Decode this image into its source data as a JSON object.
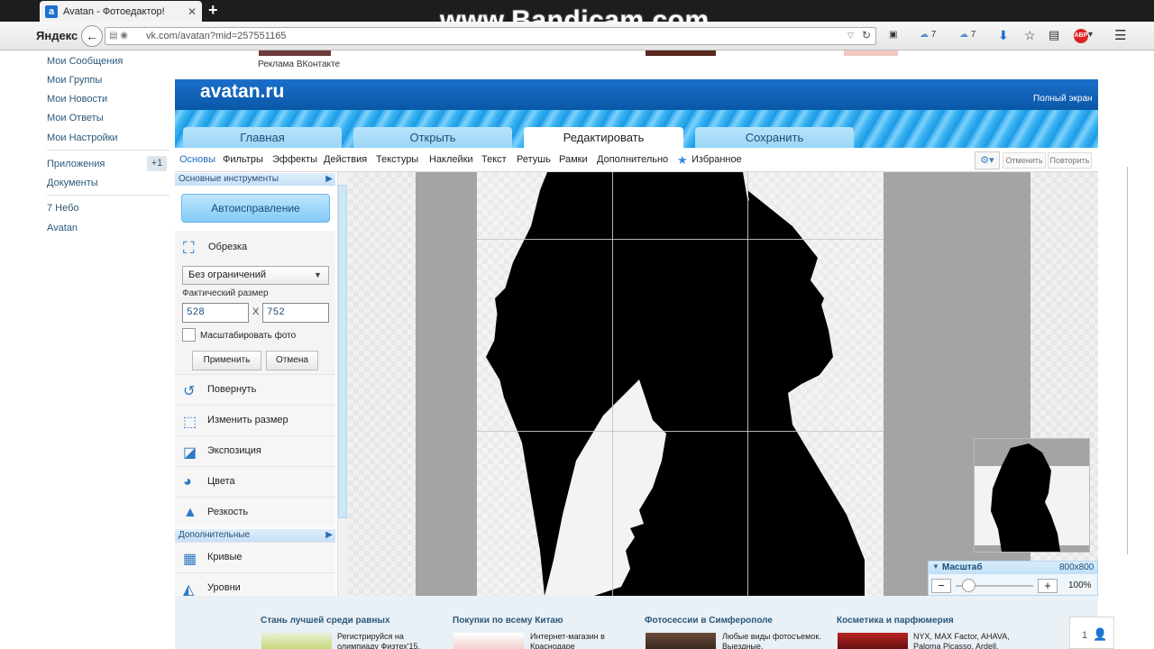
{
  "browser": {
    "tab_title": "Avatan - Фотоедактор!",
    "tab_favicon": "a",
    "watermark": "www.Bandicam.com",
    "search_brand": "Яндекс",
    "url": "vk.com/avatan?mid=257551165",
    "toolbar": {
      "cloud1_count": "7",
      "cloud2_count": "7",
      "abp": "ABP"
    }
  },
  "vk_menu": {
    "items": [
      "Мои Сообщения",
      "Мои Группы",
      "Мои Новости",
      "Мои Ответы",
      "Мои Настройки",
      "Приложения",
      "Документы",
      "7 Небо",
      "Avatan"
    ],
    "apps_badge": "+1"
  },
  "ad_top": {
    "caption": "Реклама ВКонтакте"
  },
  "avatan": {
    "logo": "avatan.ru",
    "fullscreen": "Полный экран",
    "tabs": [
      "Главная",
      "Открыть",
      "Редактировать",
      "Сохранить"
    ],
    "menu": [
      "Основы",
      "Фильтры",
      "Эффекты",
      "Действия",
      "Текстуры",
      "Наклейки",
      "Текст",
      "Ретушь",
      "Рамки",
      "Дополнительно",
      "Избранное"
    ],
    "undo": "Отменить",
    "redo": "Повторить"
  },
  "tools_panel": {
    "section_basic": "Основные инструменты",
    "auto_button": "Автоисправление",
    "crop": {
      "title": "Обрезка",
      "aspect": "Без ограничений",
      "size_label": "Фактический размер",
      "width": "528",
      "height": "752",
      "sep": "X",
      "scale_label": "Масштабировать фото",
      "apply": "Применить",
      "cancel": "Отмена"
    },
    "tools": [
      "Повернуть",
      "Изменить размер",
      "Экспозиция",
      "Цвета",
      "Резкость"
    ],
    "section_extra": "Дополнительные",
    "extra_tools": [
      "Кривые",
      "Уровни"
    ]
  },
  "zoom": {
    "title": "Масштаб",
    "size": "800x800",
    "percent": "100%",
    "level": 0.1
  },
  "bottom_ads": [
    {
      "title": "Стань лучшей среди равных",
      "text": "Регистрируйся на олимпиаду Физтех'15."
    },
    {
      "title": "Покупки по всему Китаю",
      "text": "Интернет-магазин в Краснодаре"
    },
    {
      "title": "Фотосессии в Симферополе",
      "text": "Любые виды фотосъемок. Выездные."
    },
    {
      "title": "Косметика и парфюмерия",
      "text": "NYX, MAX Factor, AHAVA, Paloma Picasso, Ardell, Paul Mitchell"
    }
  ],
  "chat": {
    "count": "1"
  },
  "colors": {
    "avatan_blue": "#0a57a8",
    "vk_link": "#2b587a",
    "accent": "#2d7ac5"
  }
}
